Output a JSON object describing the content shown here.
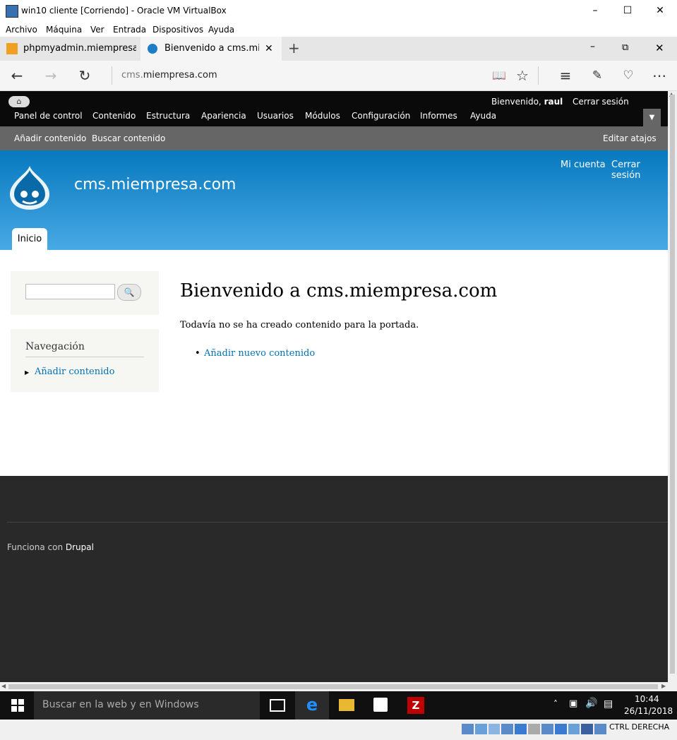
{
  "vbox": {
    "title": "win10 cliente [Corriendo] - Oracle VM VirtualBox",
    "menu": [
      "Archivo",
      "Máquina",
      "Ver",
      "Entrada",
      "Dispositivos",
      "Ayuda"
    ],
    "status_host_key": "CTRL DERECHA"
  },
  "browser": {
    "tabs": [
      {
        "label": "phpmyadmin.miempresa.cor"
      },
      {
        "label": "Bienvenido a cms.miemp"
      }
    ],
    "address_prefix": "cms.",
    "address_domain": "miempresa.com"
  },
  "toolbar": {
    "welcome_prefix": "Bienvenido, ",
    "welcome_user": "raul",
    "logout": "Cerrar sesión",
    "menu": [
      "Panel de control",
      "Contenido",
      "Estructura",
      "Apariencia",
      "Usuarios",
      "Módulos",
      "Configuración",
      "Informes",
      "Ayuda"
    ]
  },
  "shortcuts": {
    "items": [
      "Añadir contenido",
      "Buscar contenido"
    ],
    "edit": "Editar atajos"
  },
  "header": {
    "site_name": "cms.miempresa.com",
    "secondary": [
      "Mi cuenta",
      "Cerrar sesión"
    ],
    "tab": "Inicio"
  },
  "sidebar": {
    "nav_title": "Navegación",
    "nav_items": [
      "Añadir contenido"
    ]
  },
  "main": {
    "title": "Bienvenido a cms.miempresa.com",
    "text": "Todavía no se ha creado contenido para la portada.",
    "link": "Añadir nuevo contenido"
  },
  "footer": {
    "powered_prefix": "Funciona con ",
    "powered_link": "Drupal"
  },
  "taskbar": {
    "search_placeholder": "Buscar en la web y en Windows",
    "time": "10:44",
    "date": "26/11/2018"
  }
}
